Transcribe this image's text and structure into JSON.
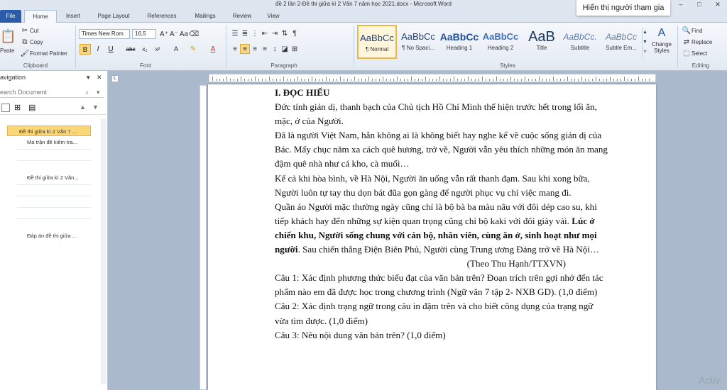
{
  "window": {
    "title": "đề 2 lần 2-Đề thi giữa kì 2 Văn 7 năm học 2021.docx - Microsoft Word",
    "overlay_badge": "Hiển thị người tham gia",
    "controls": [
      "–",
      "□",
      "✕"
    ]
  },
  "tabs": [
    "File",
    "Home",
    "Insert",
    "Page Layout",
    "References",
    "Mailings",
    "Review",
    "View"
  ],
  "clipboard": {
    "paste": "Paste",
    "cut": "Cut",
    "copy": "Copy",
    "format_painter": "Format Painter",
    "label": "Clipboard"
  },
  "font": {
    "name": "Times New Rom",
    "size": "16,5",
    "label": "Font"
  },
  "paragraph": {
    "label": "Paragraph"
  },
  "styles": {
    "label": "Styles",
    "items": [
      {
        "sample": "AaBbCc",
        "name": "¶ Normal"
      },
      {
        "sample": "AaBbCc",
        "name": "¶ No Spaci..."
      },
      {
        "sample": "AaBbCc",
        "name": "Heading 1"
      },
      {
        "sample": "AaBbCc",
        "name": "Heading 2"
      },
      {
        "sample": "AaB",
        "name": "Title"
      },
      {
        "sample": "AaBbCc.",
        "name": "Subtitle"
      },
      {
        "sample": "AaBbCc",
        "name": "Subtle Em..."
      }
    ],
    "change_styles": "Change Styles"
  },
  "editing": {
    "label": "Editing",
    "find": "Find",
    "replace": "Replace",
    "select": "Select"
  },
  "navigation": {
    "title": "avigation",
    "search_placeholder": "earch Document",
    "items": [
      "Đề thi giữa kì 2 Văn 7 ...",
      "Ma trận đề kiểm tra...",
      "Đề thi giữa kì 2 Văn...",
      "Đáp án đề thi giữa ..."
    ]
  },
  "document": {
    "heading": "I. ĐỌC HIỂU",
    "p1": "Đức tính giản dị, thanh bạch của Chủ tịch Hồ Chí Minh thể hiện trước hết trong lối ăn, mặc, ở của Người.",
    "p2": "Đã là người Việt Nam, hẳn không ai là không biết hay nghe kể về cuộc sống giản dị của Bác. Mấy chục năm xa cách quê hương, trở về, Người vẫn yêu thích những món ăn mang đậm quê nhà như cá kho, cà muối…",
    "p3": "Kể cả khi hòa bình, về Hà Nội, Người ăn uống vẫn rất thanh đạm. Sau khi xong bữa, Người luôn tự tay thu dọn bát đũa gọn gàng để người phục vụ chỉ việc mang đi.",
    "p4_a": "Quần áo Người mặc thường ngày cũng chỉ là bộ bà ba màu nâu với đôi dép cao su, khi tiếp khách hay đến những sự kiện quan trọng cũng chỉ bộ kaki với đôi giày vải. ",
    "p4_bold": "Lúc ở chiến khu, Người sống chung với cán bộ, nhân viên, cùng ăn ở, sinh hoạt như mọi người",
    "p4_b": ". Sau chiến thắng Điện Biên Phủ, Người cùng Trung ương Đảng trở về Hà Nội…",
    "source": "(Theo Thu Hạnh/TTXVN)",
    "q1": "Câu 1: Xác định phương thức biểu đạt của văn bản trên? Đoạn trích trên gợi nhớ đến tác phẩm nào em đã được học trong chương trình (Ngữ văn 7 tập 2- NXB GD). (1,0 điểm)",
    "q2": "Câu 2: Xác định trạng ngữ trong câu in đậm trên và cho biết công dụng của trạng ngữ vừa tìm được. (1,0 điểm)",
    "q3": "Câu 3: Nêu nội dung văn bản trên? (1,0 điểm)"
  },
  "watermark": "Activ"
}
